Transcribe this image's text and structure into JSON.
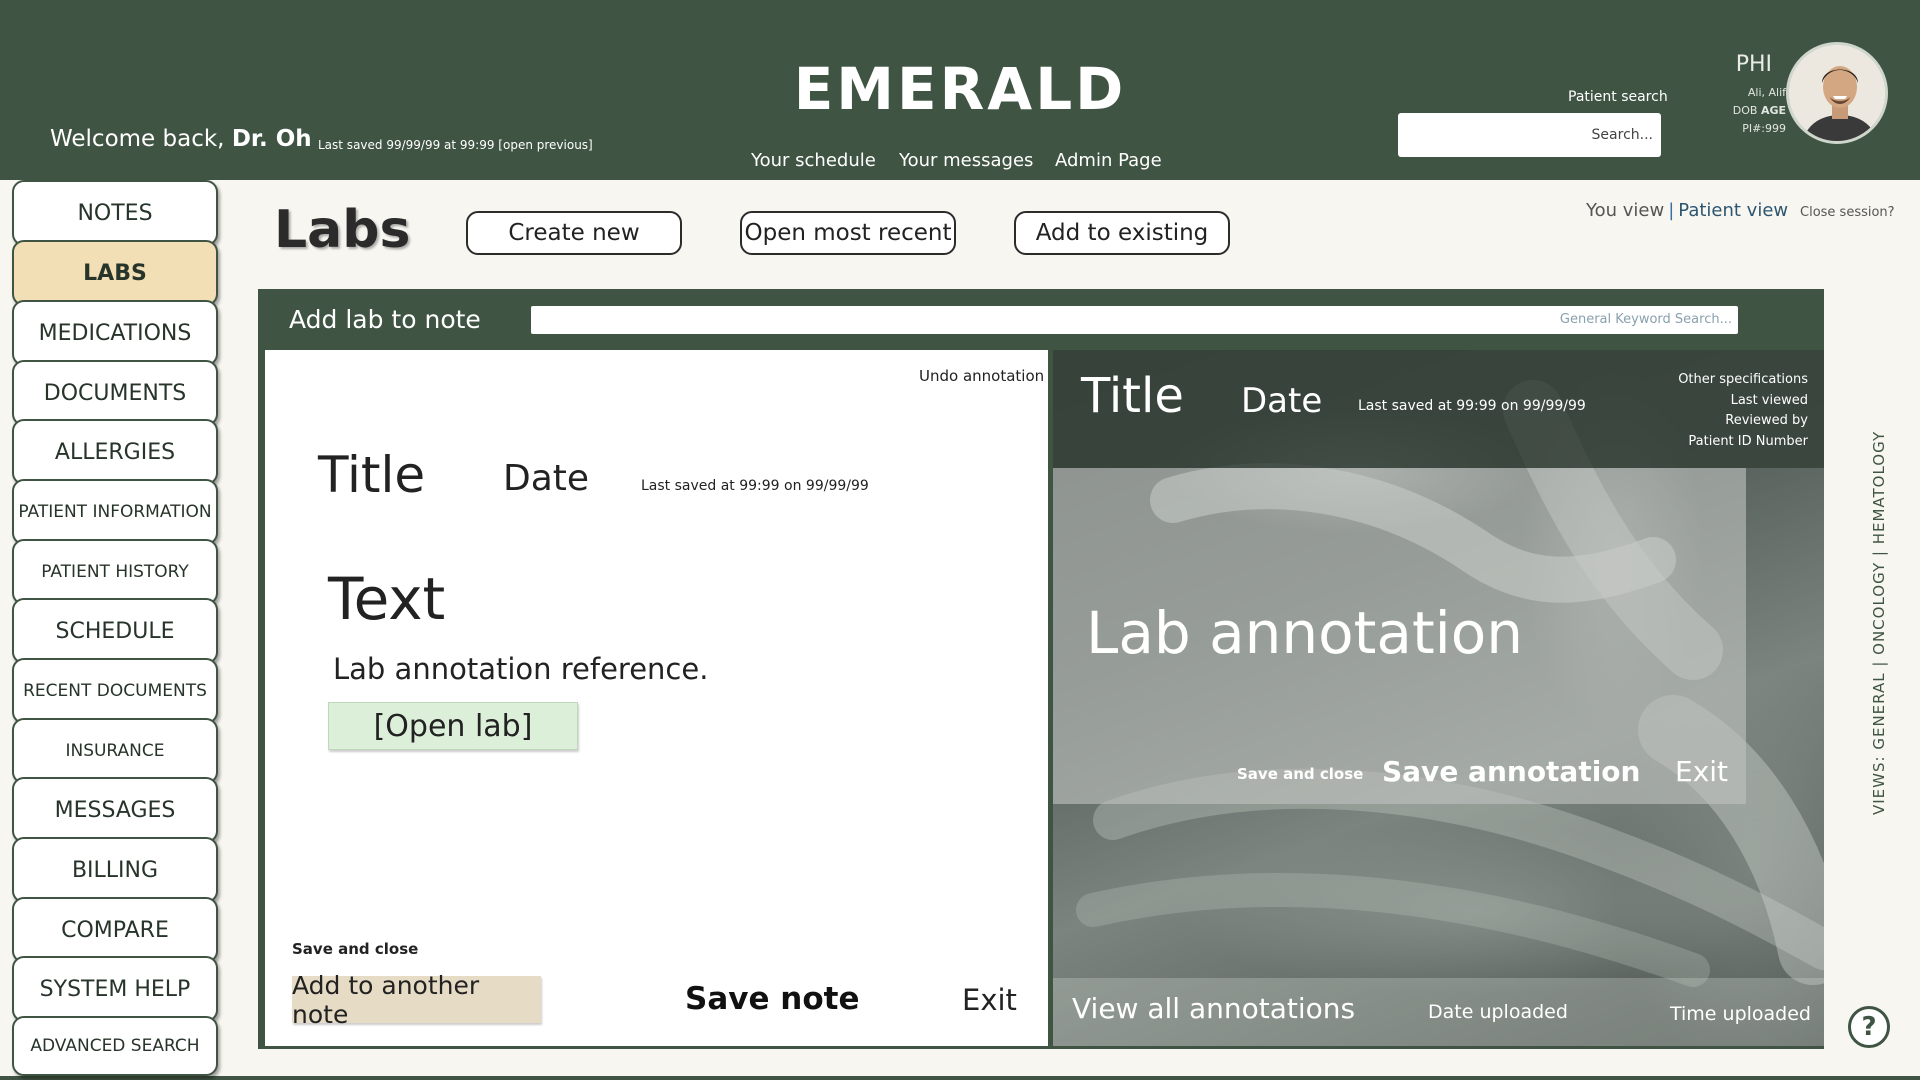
{
  "header": {
    "brand": "EMERALD",
    "welcome_prefix": "Welcome back,",
    "welcome_name": "Dr. Oh",
    "last_saved": "Last saved 99/99/99 at 99:99  [open previous]",
    "nav": [
      "Your schedule",
      "Your messages",
      "Admin Page"
    ],
    "patient_search_label": "Patient search",
    "search_placeholder": "Search...",
    "phi": {
      "label": "PHI",
      "name": "Ali, Alif",
      "dob_prefix": "DOB",
      "dob_value": "AGE",
      "pi": "PI#:999"
    }
  },
  "sidebar": {
    "items": [
      {
        "label": "NOTES",
        "active": false
      },
      {
        "label": "LABS",
        "active": true
      },
      {
        "label": "MEDICATIONS",
        "active": false
      },
      {
        "label": "DOCUMENTS",
        "active": false
      },
      {
        "label": "ALLERGIES",
        "active": false
      },
      {
        "label": "PATIENT INFORMATION",
        "active": false
      },
      {
        "label": "PATIENT HISTORY",
        "active": false
      },
      {
        "label": "SCHEDULE",
        "active": false
      },
      {
        "label": "RECENT DOCUMENTS",
        "active": false
      },
      {
        "label": "INSURANCE",
        "active": false
      },
      {
        "label": "MESSAGES",
        "active": false
      },
      {
        "label": "BILLING",
        "active": false
      },
      {
        "label": "COMPARE",
        "active": false
      },
      {
        "label": "SYSTEM HELP",
        "active": false
      },
      {
        "label": "ADVANCED SEARCH",
        "active": false
      }
    ]
  },
  "page": {
    "title": "Labs",
    "actions": [
      "Create new",
      "Open most recent",
      "Add to existing"
    ],
    "view_you": "You view",
    "view_sep": "|",
    "view_patient": "Patient view",
    "close_session": "Close session?",
    "views_vertical": "VIEWS: GENERAL | ONCOLOGY | HEMATOLOGY",
    "help": "?"
  },
  "panel": {
    "title": "Add lab to note",
    "keyword_placeholder": "General Keyword Search...",
    "note": {
      "undo": "Undo annotation",
      "title": "Title",
      "date": "Date",
      "last_saved": "Last saved at 99:99 on 99/99/99",
      "text": "Text",
      "reference": "Lab annotation reference.",
      "open_lab": "[Open lab]",
      "save_close": "Save and close",
      "add_another": "Add to another note",
      "save_note": "Save note",
      "exit": "Exit"
    },
    "lab": {
      "title": "Title",
      "date": "Date",
      "last_saved": "Last saved at 99:99 on 99/99/99",
      "specs": [
        "Other specifications",
        "Last viewed",
        "Reviewed by",
        "Patient ID Number"
      ],
      "annotation": "Lab annotation",
      "save_close": "Save and close",
      "save_annotation": "Save annotation",
      "exit": "Exit",
      "view_all": "View all annotations",
      "date_uploaded": "Date uploaded",
      "time_uploaded": "Time uploaded"
    }
  },
  "colors": {
    "header_bg": "#3f5442",
    "active_tab": "#f2dfb5",
    "open_lab_bg": "#dcefd9",
    "add_note_bg": "#e6dcc6"
  }
}
